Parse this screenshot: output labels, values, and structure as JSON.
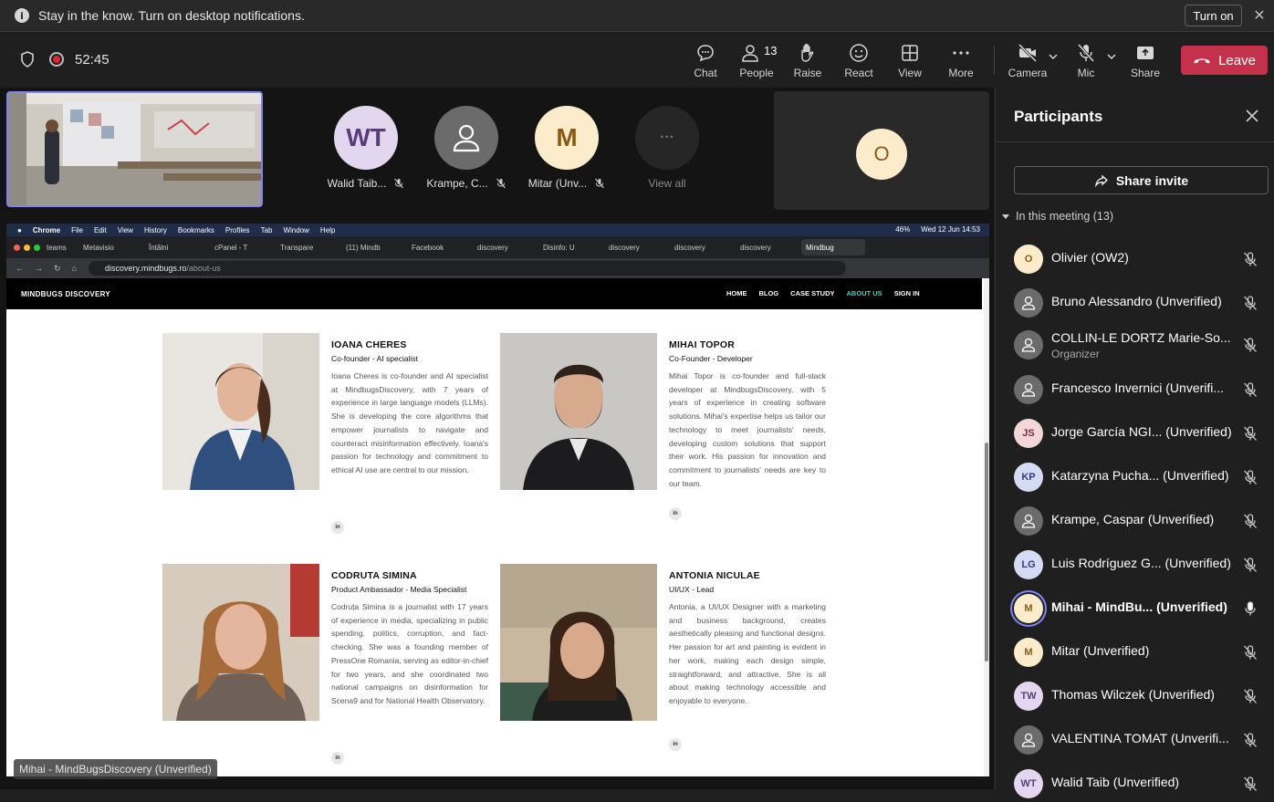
{
  "banner": {
    "message": "Stay in the know. Turn on desktop notifications.",
    "turn_on": "Turn on",
    "close": "✕"
  },
  "meeting": {
    "timer": "52:45"
  },
  "toolbar": {
    "chat": "Chat",
    "people": "People",
    "people_count": "13",
    "raise": "Raise",
    "react": "React",
    "view": "View",
    "more": "More",
    "camera": "Camera",
    "mic": "Mic",
    "share": "Share",
    "leave": "Leave"
  },
  "tiles": [
    {
      "initials": "WT",
      "name": "Walid Taib..."
    },
    {
      "initials": "",
      "name": "Krampe, C..."
    },
    {
      "initials": "M",
      "name": "Mitar (Unv..."
    },
    {
      "initials": "···",
      "name": "View all"
    }
  ],
  "big_tile": {
    "initials": "O"
  },
  "caption": "Mihai - MindBugsDiscovery (Unverified)",
  "browser": {
    "menu": [
      "Chrome",
      "File",
      "Edit",
      "View",
      "History",
      "Bookmarks",
      "Profiles",
      "Tab",
      "Window",
      "Help"
    ],
    "clock": "Wed 12 Jun 14:53",
    "battery": "46%",
    "tabs": [
      "teams",
      "Metavisio",
      "Întâlni",
      "cPanel - T",
      "Transpare",
      "(11) Mindb",
      "Facebook",
      "discovery",
      "Disinfo: U",
      "discovery",
      "discovery",
      "discovery",
      "Mindbug"
    ],
    "url_host": "discovery.mindbugs.ro",
    "url_path": "/about-us"
  },
  "site": {
    "logo": "MINDBUGS DISCOVERY",
    "nav": [
      "HOME",
      "BLOG",
      "CASE STUDY",
      "ABOUT US",
      "SIGN IN"
    ],
    "linkedin": "in",
    "team": [
      {
        "name": "IOANA CHERES",
        "role": "Co-founder - AI specialist",
        "bio": "Ioana Cheres is co-founder and AI specialist at MindbugsDiscovery, with 7 years of experience in large language models (LLMs). She is developing the core algorithms that empower journalists to navigate and counteract misinformation effectively. Ioana's passion for technology and commitment to ethical AI use are central to our mission."
      },
      {
        "name": "MIHAI TOPOR",
        "role": "Co-Founder - Developer",
        "bio": "Mihai Topor is co-founder and full-stack developer at MindbugsDiscovery, with 5 years of experience in creating software solutions. Mihai's expertise helps us tailor our technology to meet journalists' needs, developing custom solutions that support their work. His passion for innovation and commitment to journalists' needs are key to our team."
      },
      {
        "name": "CODRUTA SIMINA",
        "role": "Product Ambassador - Media Specialist",
        "bio": "Codruța Simina is a journalist with 17 years of experience in media, specializing in public spending, politics, corruption, and fact-checking. She was a founding member of PressOne Romania, serving as editor-in-chief for two years, and she coordinated two national campaigns on disinformation for Scena9 and for National Health Observatory."
      },
      {
        "name": "ANTONIA NICULAE",
        "role": "UI/UX - Lead",
        "bio": "Antonia, a UI/UX Designer with a marketing and business background, creates aesthetically pleasing and functional designs. Her passion for art and painting is evident in her work, making each design simple, straightforward, and attractive. She is all about making technology accessible and enjoyable to everyone."
      }
    ]
  },
  "panel": {
    "title": "Participants",
    "share_invite": "Share invite",
    "section": "In this meeting (13)",
    "participants": [
      {
        "initials": "O",
        "name": "Olivier (OW2)",
        "bg": "#fdeccb",
        "fg": "#8a5a14"
      },
      {
        "initials": "",
        "name": "Bruno Alessandro (Unverified)",
        "bg": "#6b6b6b",
        "fg": "#fff"
      },
      {
        "initials": "",
        "name": "COLLIN-LE DORTZ Marie-So...",
        "sub": "Organizer",
        "bg": "#6b6b6b",
        "fg": "#fff"
      },
      {
        "initials": "",
        "name": "Francesco Invernici (Unverifi...",
        "bg": "#6b6b6b",
        "fg": "#fff"
      },
      {
        "initials": "JS",
        "name": "Jorge García NGI... (Unverified)",
        "bg": "#f3d6d8",
        "fg": "#7a2d36"
      },
      {
        "initials": "KP",
        "name": "Katarzyna Pucha... (Unverified)",
        "bg": "#d4dcf5",
        "fg": "#2d3d7a"
      },
      {
        "initials": "",
        "name": "Krampe, Caspar (Unverified)",
        "bg": "#6b6b6b",
        "fg": "#fff"
      },
      {
        "initials": "LG",
        "name": "Luis Rodríguez G... (Unverified)",
        "bg": "#d4dcf5",
        "fg": "#2d3d7a"
      },
      {
        "initials": "M",
        "name": "Mihai - MindBu...  (Unverified)",
        "bg": "#fdeccb",
        "fg": "#8a5a14",
        "speaking": true
      },
      {
        "initials": "M",
        "name": "Mitar (Unverified)",
        "bg": "#fdeccb",
        "fg": "#8a5a14"
      },
      {
        "initials": "TW",
        "name": "Thomas Wilczek (Unverified)",
        "bg": "#e3d7f0",
        "fg": "#5a3d7a"
      },
      {
        "initials": "",
        "name": "VALENTINA TOMAT (Unverifi...",
        "bg": "#6b6b6b",
        "fg": "#fff"
      },
      {
        "initials": "WT",
        "name": "Walid Taib (Unverified)",
        "bg": "#e3d7f0",
        "fg": "#5a3d7a"
      }
    ]
  }
}
